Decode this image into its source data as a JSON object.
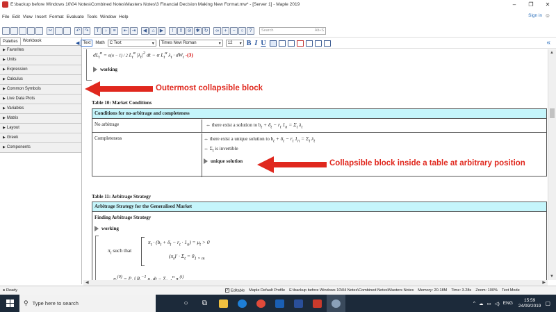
{
  "window": {
    "title": "E:\\backup before Windows 10\\04 Notes\\Combined Notes\\Masters Notes\\3 Financial Decision Making New Format.mw* - [Server 1] - Maple 2019",
    "minimize": "–",
    "maximize": "❐",
    "close": "✕"
  },
  "menu": {
    "items": [
      "File",
      "Edit",
      "View",
      "Insert",
      "Format",
      "Evaluate",
      "Tools",
      "Window",
      "Help"
    ],
    "signin": "Sign in"
  },
  "toolbar": {
    "search_placeholder": "Search",
    "search_shortcut": "Alt+S"
  },
  "palettes": {
    "tabs": [
      "Palettes",
      "Workbook"
    ],
    "items": [
      "Favorites",
      "Units",
      "Expression",
      "Calculus",
      "Common Symbols",
      "Live Data Plots",
      "Variables",
      "Matrix",
      "Layout",
      "Greek",
      "Components"
    ]
  },
  "context_bar": {
    "mode_text": "Text",
    "mode_math": "Math",
    "style": "C  Text",
    "font": "Times New Roman",
    "size": "12",
    "bold": "B",
    "italic": "I",
    "underline": "U"
  },
  "document": {
    "eq_top_label": "-(3)",
    "working_label": "working",
    "table10": {
      "caption": "Table 10: Market Conditions",
      "header": "Conditions for no-arbitrage and completeness",
      "row1_label": "No arbitrage",
      "row1_value": "⇔ there exist a solution to b",
      "row2_label": "Completeness",
      "row2_value1": "⇔ there exist a unique solution to b",
      "row2_value2": "⇔ Σ",
      "row2_value2_tail": " is invertible",
      "collapsible_label": "unique solution"
    },
    "table11": {
      "caption": "Table 11: Arbitrage Strategy",
      "header": "Arbitrage Strategy for the Generalised Market",
      "subheader": "Finding Arbitrage Strategy",
      "working_label": "working",
      "such_that": "such that"
    }
  },
  "annotations": {
    "outer": "Outermost collapsible block",
    "inner": "Collapsible block inside a table at arbitrary position"
  },
  "status": {
    "ready": "Ready",
    "editable": "Editable",
    "profile": "Maple Default Profile",
    "path": "E:\\backup before Windows 10\\04 Notes\\Combined Notes\\Masters Notes",
    "memory": "Memory: 20.18M",
    "time": "Time: 3.28s",
    "zoom": "Zoom: 100%",
    "mode": "Text Mode"
  },
  "taskbar": {
    "search_placeholder": "Type here to search",
    "lang": "ENG",
    "time": "15:59",
    "date": "24/09/2019"
  },
  "colors": {
    "table_header": "#c5f5fb",
    "annotation": "#e0281e",
    "taskbar": "#1c2a3a"
  }
}
